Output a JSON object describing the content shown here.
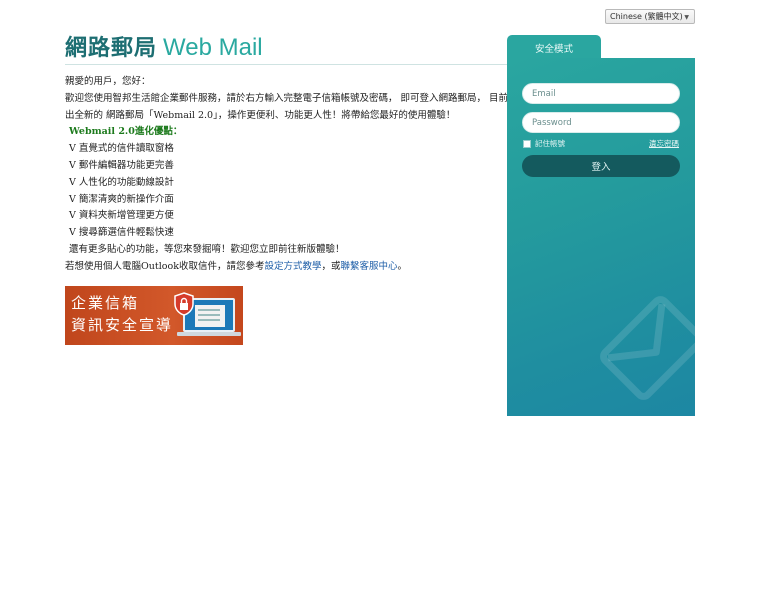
{
  "language": {
    "selected": "Chinese (繁體中文)"
  },
  "brand": {
    "name_cn": "網路郵局",
    "name_en": "Web Mail"
  },
  "intro": {
    "greeting": "親愛的用戶，您好：",
    "line1": "歡迎您使用智邦生活館企業郵件服務，請於右方輸入完整電子信箱帳號及密碼， 即可登入網路郵局， 目前推",
    "line2": "出全新的 網路郵局「Webmail 2.0」，操作更便利、功能更人性！將帶給您最好的使用體驗！"
  },
  "features": {
    "title": "Webmail 2.0進化優點：",
    "items": [
      "V 直覺式的信件讀取窗格",
      "V 郵件編輯器功能更完善",
      "V 人性化的功能動線設計",
      "V 簡潔清爽的新操作介面",
      "V 資料夾新增管理更方便",
      "V 搜尋篩選信件輕鬆快速"
    ],
    "more": "還有更多貼心的功能，等您來發掘唷！歡迎您立即前往新版體驗！"
  },
  "outlook": {
    "prefix": "若想使用個人電腦Outlook收取信件，請您參考",
    "link1": "設定方式教學",
    "middle": "，或",
    "link2": "聯繫客服中心",
    "suffix": "。"
  },
  "banner": {
    "line1": "企業信箱",
    "line2": "資訊安全宣導"
  },
  "login": {
    "tab_label": "安全模式",
    "email_placeholder": "Email",
    "password_placeholder": "Password",
    "remember_label": "記住帳號",
    "forgot_label": "遺忘密碼",
    "submit_label": "登入"
  },
  "colors": {
    "accent": "#2aa6a0",
    "brand_dark": "#1d6e72",
    "button": "#145a5e",
    "banner": "#c9501f"
  }
}
